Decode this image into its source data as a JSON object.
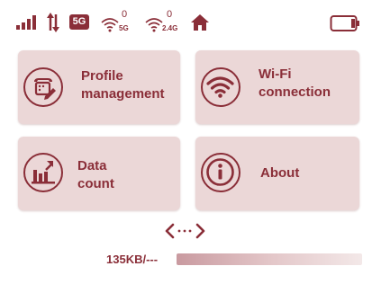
{
  "status_bar": {
    "signal_icon": "signal-bars-icon",
    "data_transfer_icon": "up-down-arrows-icon",
    "network_type": "5G",
    "wifi_5g": {
      "clients": "0",
      "band": "5G"
    },
    "wifi_24g": {
      "clients": "0",
      "band": "2.4G"
    },
    "home_icon": "home-icon",
    "battery_icon": "battery-icon"
  },
  "tiles": {
    "profile": {
      "line1": "Profile",
      "line2": "management",
      "icon": "phone-pencil-icon"
    },
    "wifi": {
      "line1": "Wi-Fi",
      "line2": "connection",
      "icon": "wifi-icon"
    },
    "data": {
      "line1": "Data",
      "line2": "count",
      "icon": "bar-chart-icon"
    },
    "about": {
      "line1": "About",
      "icon": "info-icon"
    }
  },
  "navigation": {
    "arrows_icon": "left-right-arrows-icon"
  },
  "usage": {
    "text": "135KB/---"
  },
  "colors": {
    "accent": "#8a2e38",
    "tile_bg": "#ebd7d7",
    "background": "#ffffff"
  }
}
